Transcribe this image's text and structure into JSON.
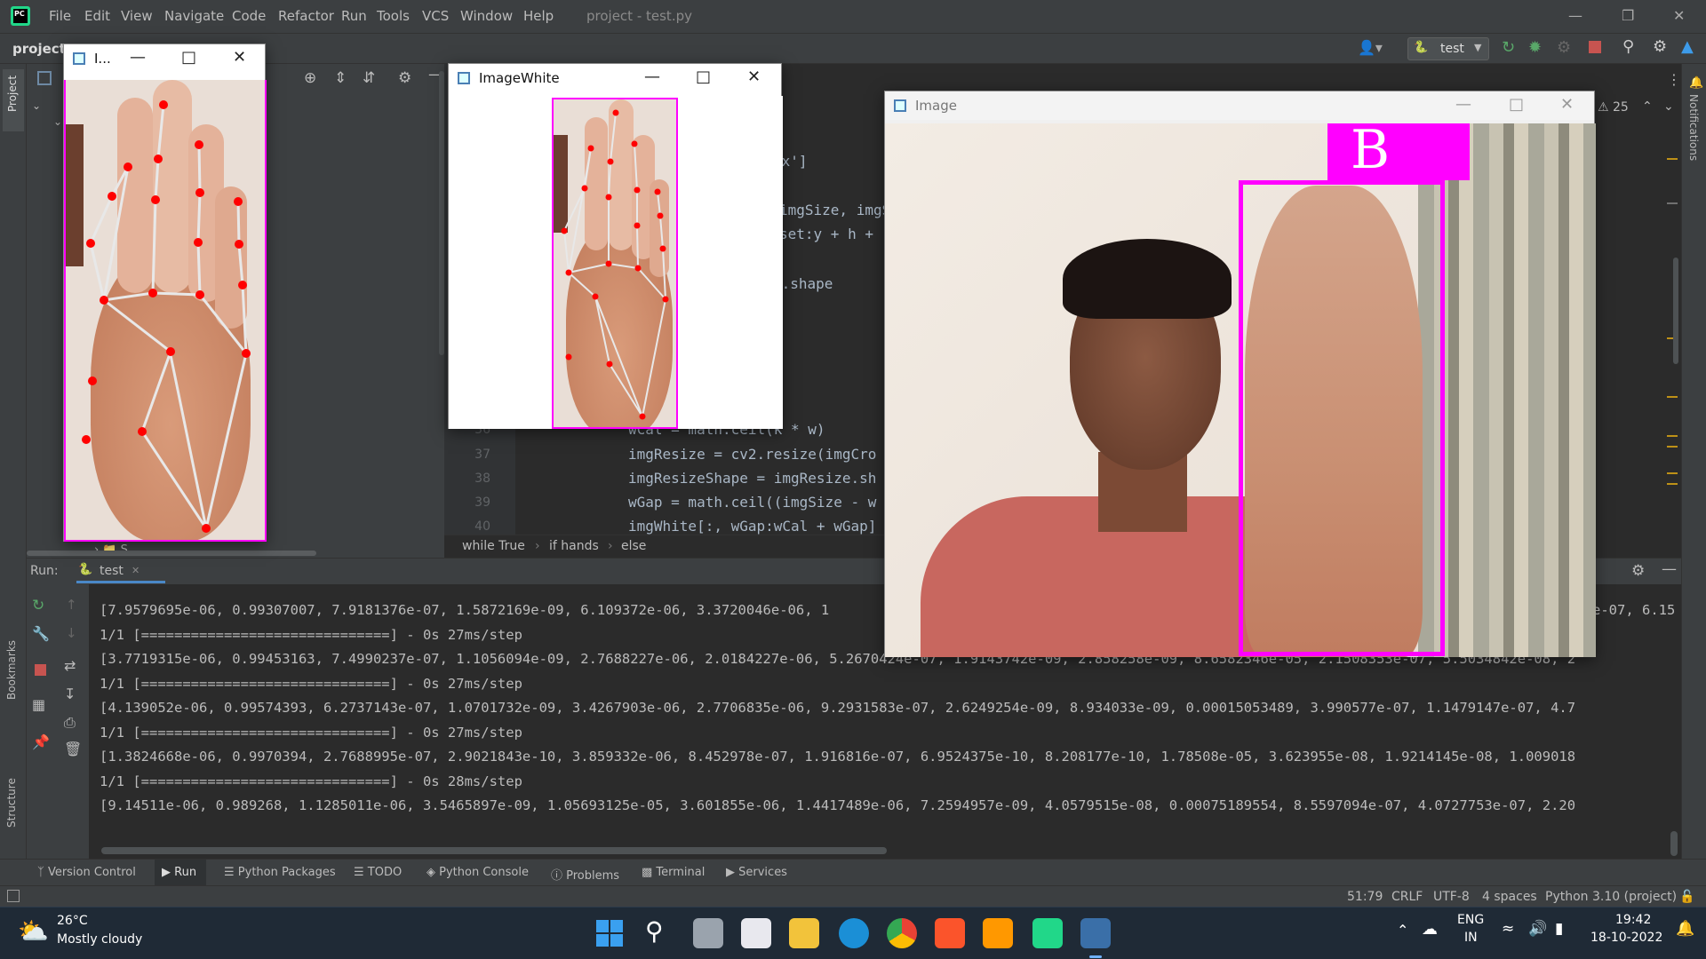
{
  "menubar": {
    "items": [
      "File",
      "Edit",
      "View",
      "Navigate",
      "Code",
      "Refactor",
      "Run",
      "Tools",
      "VCS",
      "Window",
      "Help"
    ],
    "title": "project - test.py"
  },
  "toolbar": {
    "project_label": "project",
    "run_config": "test"
  },
  "editor": {
    "warnings_count": "25",
    "code_fragments": [
      {
        "text": "ox']"
      },
      {
        "text": "imgSize, imgS"
      },
      {
        "text": "set:y + h +"
      },
      {
        "text": "p.shape"
      }
    ],
    "lines": [
      {
        "num": "36",
        "text": "wCal = math.ceil(k * w)"
      },
      {
        "num": "37",
        "text": "imgResize = cv2.resize(imgCro"
      },
      {
        "num": "38",
        "text": "imgResizeShape = imgResize.sh"
      },
      {
        "num": "39",
        "text": "wGap = math.ceil((imgSize - w"
      },
      {
        "num": "40",
        "text": "imgWhite[:, wGap:wCal + wGap]"
      }
    ],
    "breadcrumbs": [
      "while True",
      "if hands",
      "else"
    ]
  },
  "project_tree": {
    "item": "S"
  },
  "run": {
    "label": "Run:",
    "tab": "test",
    "console_lines": [
      "[7.9579695e-06, 0.99307007, 7.9181376e-07, 1.5872169e-09, 6.109372e-06, 3.3720046e-06, 1",
      "1/1 [==============================] - 0s 27ms/step",
      "[3.7719315e-06, 0.99453163, 7.4990237e-07, 1.1056094e-09, 2.7688227e-06, 2.0184227e-06, 5.2670424e-07, 1.9143742e-09, 2.858258e-09, 8.6582346e-05, 2.1508353e-07, 5.5034842e-08, 2",
      "1/1 [==============================] - 0s 27ms/step",
      "[4.139052e-06, 0.99574393, 6.2737143e-07, 1.0701732e-09, 3.4267903e-06, 2.7706835e-06, 9.2931583e-07, 2.6249254e-09, 8.934033e-09, 0.00015053489, 3.990577e-07, 1.1479147e-07, 4.7",
      "1/1 [==============================] - 0s 27ms/step",
      "[1.3824668e-06, 0.9970394, 2.7688995e-07, 2.9021843e-10, 3.859332e-06, 8.452978e-07, 1.916816e-07, 6.9524375e-10, 8.208177e-10, 1.78508e-05, 3.623955e-08, 1.9214145e-08, 1.009018",
      "1/1 [==============================] - 0s 28ms/step",
      "[9.14511e-06, 0.989268, 1.1285011e-06, 3.5465897e-09, 1.05693125e-05, 3.601855e-06, 1.4417489e-06, 7.2594957e-09, 4.0579515e-08, 0.00075189554, 8.5597094e-07, 4.0727753e-07, 2.20"
    ],
    "line0_tail": "e-07, 6.15"
  },
  "bottom_tabs": [
    "Version Control",
    "Run",
    "Python Packages",
    "TODO",
    "Python Console",
    "Problems",
    "Terminal",
    "Services"
  ],
  "statusbar": {
    "position": "51:79",
    "line_sep": "CRLF",
    "encoding": "UTF-8",
    "indent": "4 spaces",
    "interpreter": "Python 3.10 (project)"
  },
  "side_labels": {
    "project": "Project",
    "bookmarks": "Bookmarks",
    "structure": "Structure",
    "notifications": "Notifications"
  },
  "windows": {
    "crop_title": "I...",
    "white_title": "ImageWhite",
    "image_title": "Image",
    "prediction_label": "B"
  },
  "taskbar": {
    "temperature": "26°C",
    "weather": "Mostly cloudy",
    "lang1": "ENG",
    "lang2": "IN",
    "time": "19:42",
    "date": "18-10-2022"
  },
  "colors": {
    "accent_magenta": "#ff00ff",
    "landmark_red": "#ff0000",
    "ide_bg": "#2b2b2b",
    "panel_bg": "#3c3f41"
  }
}
